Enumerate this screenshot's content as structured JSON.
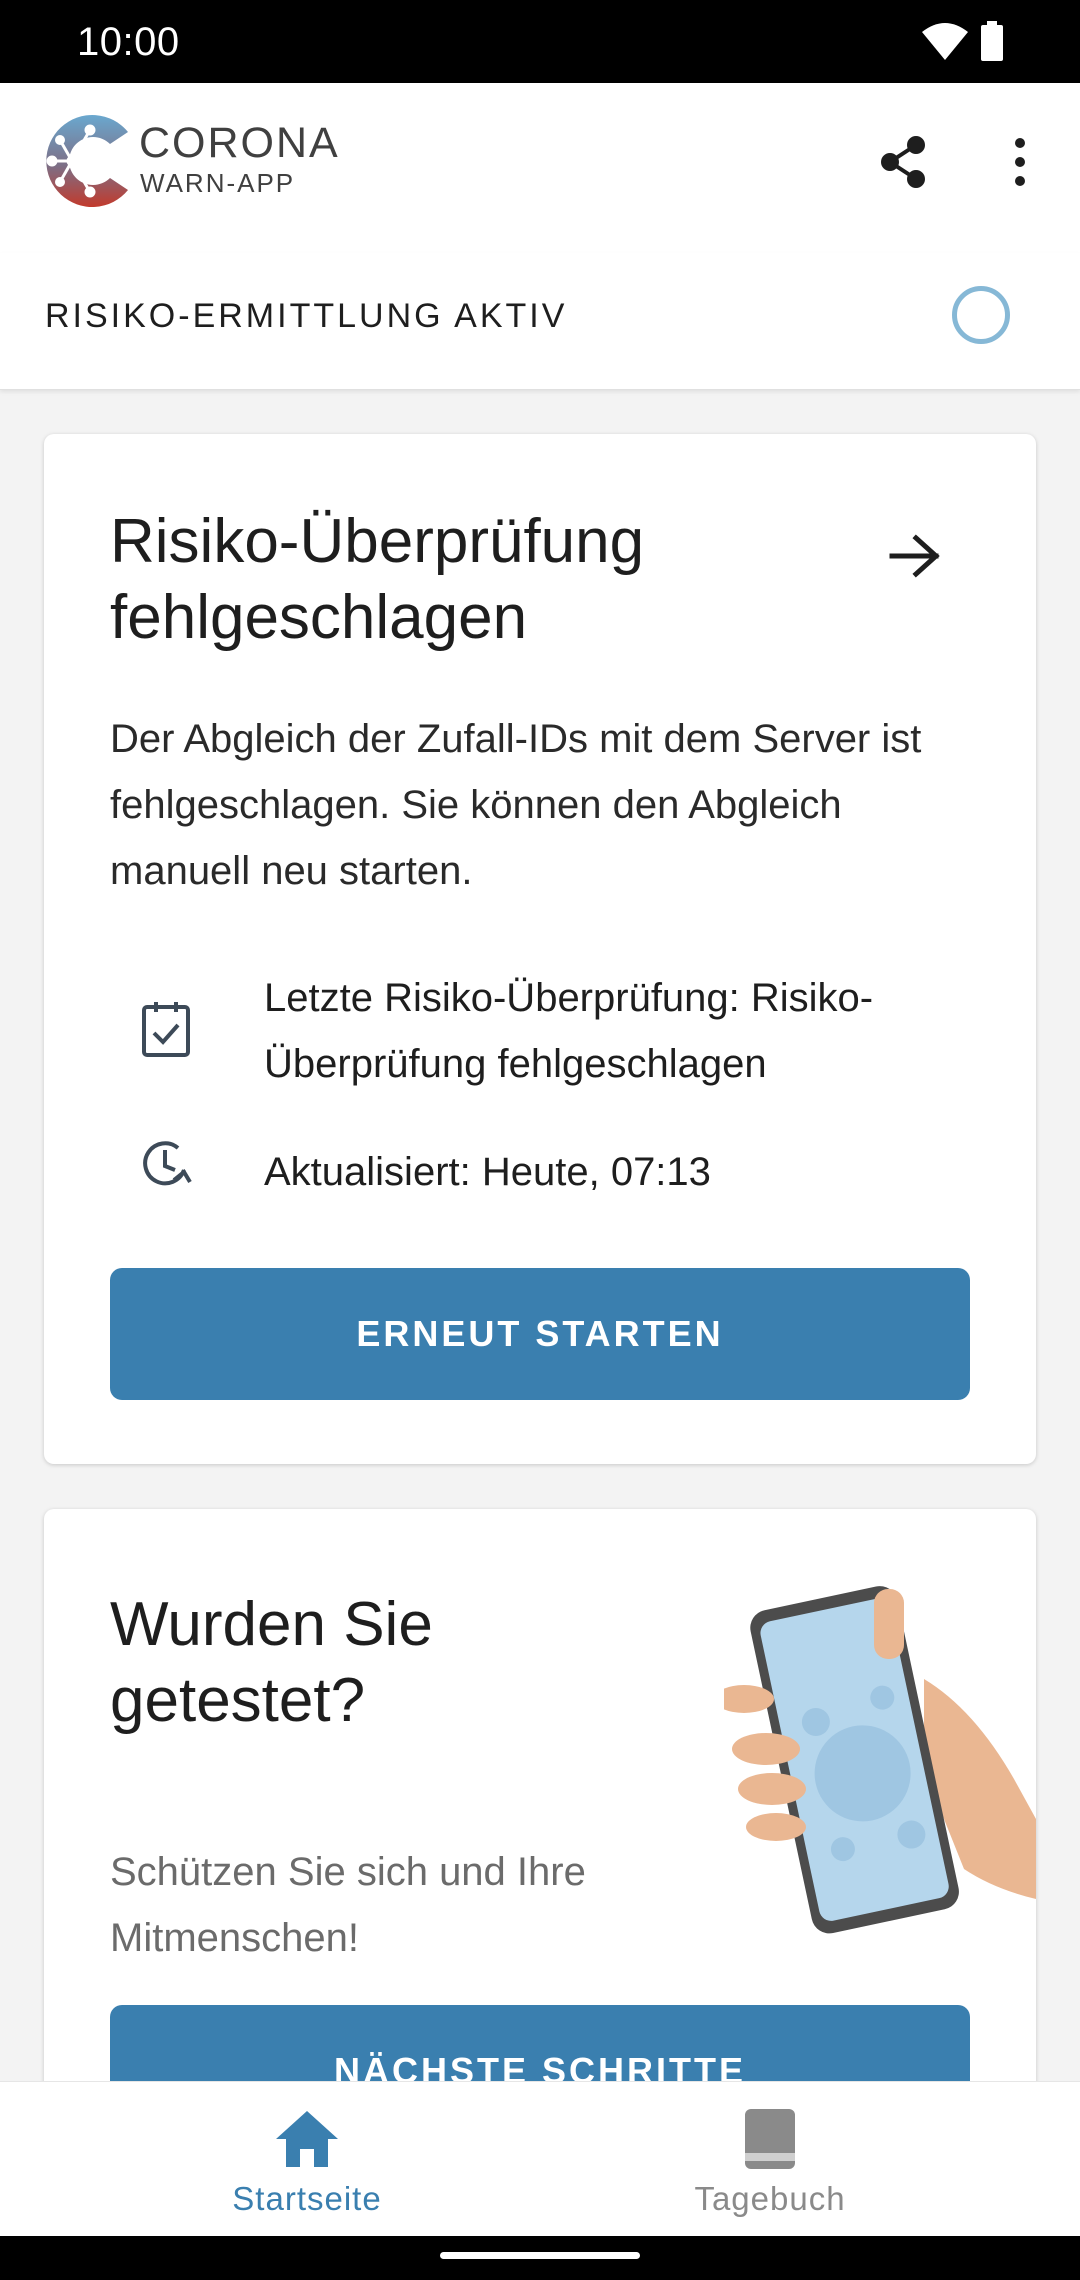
{
  "status_bar": {
    "time": "10:00"
  },
  "app_bar": {
    "brand_line1": "CORONA",
    "brand_line2": "WARN-APP"
  },
  "tracing": {
    "label": "RISIKO-ERMITTLUNG AKTIV",
    "ring_color": "#86b8d6"
  },
  "risk_card": {
    "title": "Risiko-Überprüfung fehlgeschlagen",
    "body": "Der Abgleich der Zufall-IDs mit dem Server ist fehlgeschlagen. Sie können den Abgleich manuell neu starten.",
    "last_check": "Letzte Risiko-Überprüfung: Risiko-Überprüfung fehlgeschlagen",
    "updated": "Aktualisiert: Heute, 07:13",
    "button": "ERNEUT STARTEN"
  },
  "test_card": {
    "title": "Wurden Sie getestet?",
    "subtitle": "Schützen Sie sich und Ihre Mitmenschen!",
    "button": "NÄCHSTE SCHRITTE"
  },
  "bottom_nav": {
    "items": [
      {
        "label": "Startseite",
        "icon": "home-icon",
        "active": true
      },
      {
        "label": "Tagebuch",
        "icon": "book-icon",
        "active": false
      }
    ]
  },
  "colors": {
    "primary": "#3a7faf",
    "text": "#1e1e1e",
    "muted": "#6b6b6b"
  }
}
